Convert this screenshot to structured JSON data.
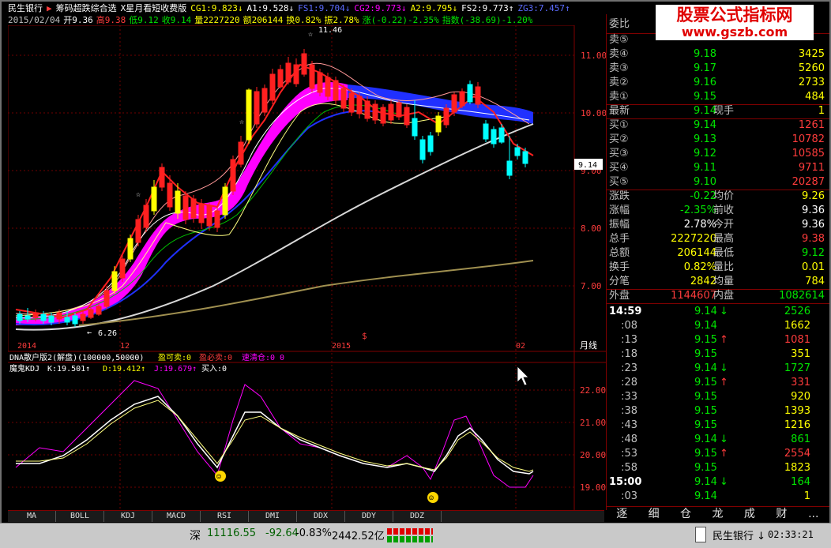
{
  "title_bar": {
    "stock_name": "民生银行",
    "indicator_name": "筹码超跌综合选",
    "ma_text": "X星月看短收费版",
    "cg1": "CG1:9.823↓",
    "a1": "A1:9.528↓",
    "fs1": "FS1:9.704↓",
    "cg2": "CG2:9.773↓",
    "a2": "A2:9.795↓",
    "fs2": "FS2:9.773↑",
    "zg3": "ZG3:7.457↑"
  },
  "info_bar": {
    "date": "2015/02/04",
    "open": "开9.36",
    "high": "高9.38",
    "low": "低9.12",
    "close": "收9.14",
    "volume": "量2227220",
    "amount": "额206144",
    "turnover": "换0.82%",
    "amplitude": "振2.78%",
    "change": "涨(-0.22)-2.35%",
    "index": "指数(-38.69)-1.20%"
  },
  "watermark": {
    "line1": "股票公式指标网",
    "line2": "www.gszb.com"
  },
  "colors": {
    "up": "#ff3c3c",
    "down": "#00ffff",
    "ma_white": "#d8d8d8",
    "ma_magenta": "#ff00ff",
    "ma_blue": "#2030ff",
    "ma_olive": "#a09050"
  },
  "chart_data": {
    "type": "candlestick",
    "period": "月线",
    "y_ticks": [
      "11.00",
      "10.00",
      "9.00",
      "8.00",
      "7.00"
    ],
    "price_tag": "9.14",
    "high_label": "11.46",
    "low_label": "6.26",
    "x_labels": [
      "2014",
      "12",
      "2015",
      "02"
    ],
    "sub_title": "DNA散户版2(解盘)(100000,50000)",
    "sub_labels": [
      "盈可卖:0",
      "盈必卖:0",
      "速清仓:0 0"
    ],
    "kdj_title": "魔鬼KDJ",
    "kdj_k": "K:19.501↑",
    "kdj_d": "D:19.412↑",
    "kdj_j": "J:19.679↑",
    "kdj_buy": "买入:0",
    "kdj_ticks": [
      "22.00",
      "21.00",
      "20.00",
      "19.00"
    ],
    "symbol_s": "$"
  },
  "bottom_tabs": [
    "MA",
    "BOLL",
    "KDJ",
    "MACD",
    "RSI",
    "DMI",
    "DDX",
    "DDY",
    "DDZ"
  ],
  "quote_panel": {
    "header": "委比",
    "asks": [
      {
        "label": "卖⑤",
        "price": "",
        "volume": ""
      },
      {
        "label": "卖④",
        "price": "9.18",
        "volume": "3425"
      },
      {
        "label": "卖③",
        "price": "9.17",
        "volume": "5260"
      },
      {
        "label": "卖②",
        "price": "9.16",
        "volume": "2733"
      },
      {
        "label": "卖①",
        "price": "9.15",
        "volume": "484"
      }
    ],
    "latest": {
      "label": "最新",
      "price": "9.14",
      "label2": "现手",
      "value2": "1"
    },
    "bids": [
      {
        "label": "买①",
        "price": "9.14",
        "volume": "1261"
      },
      {
        "label": "买②",
        "price": "9.13",
        "volume": "10782"
      },
      {
        "label": "买③",
        "price": "9.12",
        "volume": "10585"
      },
      {
        "label": "买④",
        "price": "9.11",
        "volume": "9711"
      },
      {
        "label": "买⑤",
        "price": "9.10",
        "volume": "20287"
      }
    ],
    "stats": [
      {
        "l1": "涨跌",
        "v1": "-0.22",
        "l2": "均价",
        "v2": "9.26"
      },
      {
        "l1": "涨幅",
        "v1": "-2.35%",
        "l2": "前收",
        "v2": "9.36"
      },
      {
        "l1": "振幅",
        "v1": "2.78%",
        "l2": "今开",
        "v2": "9.36"
      },
      {
        "l1": "总手",
        "v1": "2227220",
        "l2": "最高",
        "v2": "9.38"
      },
      {
        "l1": "总额",
        "v1": "206144",
        "l2": "最低",
        "v2": "9.12"
      },
      {
        "l1": "换手",
        "v1": "0.82%",
        "l2": "量比",
        "v2": "0.01"
      },
      {
        "l1": "分笔",
        "v1": "2842",
        "l2": "均量",
        "v2": "784"
      }
    ],
    "outer": {
      "label": "外盘",
      "value": "1144607",
      "label2": "内盘",
      "value2": "1082614"
    },
    "ticks": [
      {
        "time": "14:59",
        "price": "9.14",
        "arrow": "↓",
        "vol": "2526"
      },
      {
        "time": ":08",
        "price": "9.14",
        "arrow": "",
        "vol": "1662"
      },
      {
        "time": ":13",
        "price": "9.15",
        "arrow": "↑",
        "vol": "1081"
      },
      {
        "time": ":18",
        "price": "9.15",
        "arrow": "",
        "vol": "351"
      },
      {
        "time": ":23",
        "price": "9.14",
        "arrow": "↓",
        "vol": "1727"
      },
      {
        "time": ":28",
        "price": "9.15",
        "arrow": "↑",
        "vol": "331"
      },
      {
        "time": ":33",
        "price": "9.15",
        "arrow": "",
        "vol": "920"
      },
      {
        "time": ":38",
        "price": "9.15",
        "arrow": "",
        "vol": "1393"
      },
      {
        "time": ":43",
        "price": "9.15",
        "arrow": "",
        "vol": "1216"
      },
      {
        "time": ":48",
        "price": "9.14",
        "arrow": "↓",
        "vol": "861"
      },
      {
        "time": ":53",
        "price": "9.15",
        "arrow": "↑",
        "vol": "2554"
      },
      {
        "time": ":58",
        "price": "9.15",
        "arrow": "",
        "vol": "1823"
      },
      {
        "time": "15:00",
        "price": "9.14",
        "arrow": "↓",
        "vol": "164"
      },
      {
        "time": ":03",
        "price": "9.14",
        "arrow": "",
        "vol": "1"
      }
    ],
    "tabs": [
      "逐",
      "细",
      "仓",
      "龙",
      "成",
      "财",
      "..."
    ]
  },
  "status_bar": {
    "market": "深",
    "index_value": "11116.55",
    "index_change": "-92.64",
    "index_pct": "-0.83%",
    "index_amount": "2442.52亿",
    "stock_button": "民生银行 ↓",
    "clock": "02:33:21"
  }
}
